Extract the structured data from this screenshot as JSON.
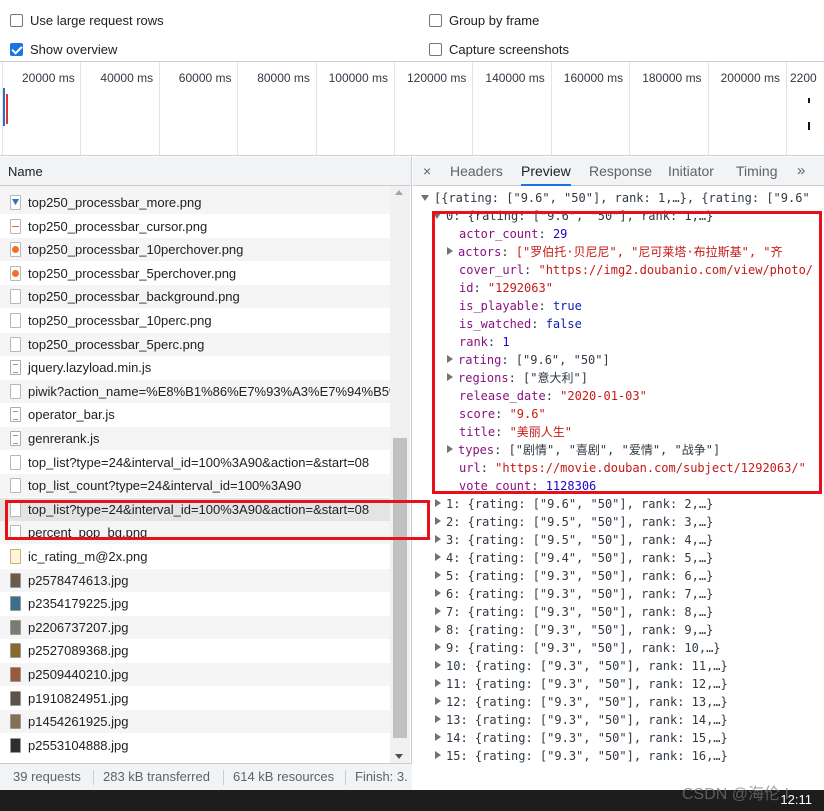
{
  "options": {
    "large_rows": "Use large request rows",
    "group_by_frame": "Group by frame",
    "show_overview": "Show overview",
    "capture_screenshots": "Capture screenshots"
  },
  "overview_ticks": [
    "20000 ms",
    "40000 ms",
    "60000 ms",
    "80000 ms",
    "100000 ms",
    "120000 ms",
    "140000 ms",
    "160000 ms",
    "180000 ms",
    "200000 ms",
    "2200"
  ],
  "list": {
    "header": "Name",
    "rows": [
      {
        "name": "top250_processbar_more.png",
        "icon": "img-blue"
      },
      {
        "name": "top250_processbar_cursor.png",
        "icon": "img-line"
      },
      {
        "name": "top250_processbar_10perchover.png",
        "icon": "img-orange"
      },
      {
        "name": "top250_processbar_5perchover.png",
        "icon": "img-orange"
      },
      {
        "name": "top250_processbar_background.png",
        "icon": "plain"
      },
      {
        "name": "top250_processbar_10perc.png",
        "icon": "plain"
      },
      {
        "name": "top250_processbar_5perc.png",
        "icon": "plain"
      },
      {
        "name": "jquery.lazyload.min.js",
        "icon": "js"
      },
      {
        "name": "piwik?action_name=%E8%B1%86%E7%93%A3%E7%94%B5%",
        "icon": "plain"
      },
      {
        "name": "operator_bar.js",
        "icon": "js"
      },
      {
        "name": "genrerank.js",
        "icon": "js"
      },
      {
        "name": "top_list?type=24&interval_id=100%3A90&action=&start=08",
        "icon": "plain"
      },
      {
        "name": "top_list_count?type=24&interval_id=100%3A90",
        "icon": "plain"
      },
      {
        "name": "top_list?type=24&interval_id=100%3A90&action=&start=08",
        "icon": "plain"
      },
      {
        "name": "percent_pop_bg.png",
        "icon": "plain"
      },
      {
        "name": "ic_rating_m@2x.png",
        "icon": "star"
      },
      {
        "name": "p2578474613.jpg",
        "icon": "photo1"
      },
      {
        "name": "p2354179225.jpg",
        "icon": "photo2"
      },
      {
        "name": "p2206737207.jpg",
        "icon": "photo3"
      },
      {
        "name": "p2527089368.jpg",
        "icon": "photo4"
      },
      {
        "name": "p2509440210.jpg",
        "icon": "photo5"
      },
      {
        "name": "p1910824951.jpg",
        "icon": "photo6"
      },
      {
        "name": "p1454261925.jpg",
        "icon": "photo7"
      },
      {
        "name": "p2553104888.jpg",
        "icon": "photo8"
      }
    ]
  },
  "tabs": {
    "close": "×",
    "items": [
      "Headers",
      "Preview",
      "Response",
      "Initiator",
      "Timing"
    ],
    "active": "Preview",
    "more": "»"
  },
  "preview": {
    "root": "[{rating: [\"9.6\", \"50\"], rank: 1,…}, {rating: [\"9.6\"",
    "item0_header": "0: {rating: [\"9.6\", \"50\"], rank: 1,…}",
    "fields": [
      {
        "key": "actor_count",
        "value": "29",
        "type": "n",
        "expandable": false
      },
      {
        "key": "actors",
        "value": "[\"罗伯托·贝尼尼\", \"尼可莱塔·布拉斯基\", \"齐",
        "type": "s",
        "expandable": true
      },
      {
        "key": "cover_url",
        "value": "\"https://img2.doubanio.com/view/photo/",
        "type": "s",
        "expandable": false
      },
      {
        "key": "id",
        "value": "\"1292063\"",
        "type": "s",
        "expandable": false
      },
      {
        "key": "is_playable",
        "value": "true",
        "type": "b",
        "expandable": false
      },
      {
        "key": "is_watched",
        "value": "false",
        "type": "b",
        "expandable": false
      },
      {
        "key": "rank",
        "value": "1",
        "type": "n",
        "expandable": false
      },
      {
        "key": "rating",
        "value": "[\"9.6\", \"50\"]",
        "type": "p",
        "expandable": true
      },
      {
        "key": "regions",
        "value": "[\"意大利\"]",
        "type": "p",
        "expandable": true
      },
      {
        "key": "release_date",
        "value": "\"2020-01-03\"",
        "type": "s",
        "expandable": false
      },
      {
        "key": "score",
        "value": "\"9.6\"",
        "type": "s",
        "expandable": false
      },
      {
        "key": "title",
        "value": "\"美丽人生\"",
        "type": "s",
        "expandable": false
      },
      {
        "key": "types",
        "value": "[\"剧情\", \"喜剧\", \"爱情\", \"战争\"]",
        "type": "p",
        "expandable": true
      },
      {
        "key": "url",
        "value": "\"https://movie.douban.com/subject/1292063/\"",
        "type": "s",
        "expandable": false
      },
      {
        "key": "vote_count",
        "value": "1128306",
        "type": "n",
        "expandable": false
      }
    ],
    "items": [
      "1: {rating: [\"9.6\", \"50\"], rank: 2,…}",
      "2: {rating: [\"9.5\", \"50\"], rank: 3,…}",
      "3: {rating: [\"9.5\", \"50\"], rank: 4,…}",
      "4: {rating: [\"9.4\", \"50\"], rank: 5,…}",
      "5: {rating: [\"9.3\", \"50\"], rank: 6,…}",
      "6: {rating: [\"9.3\", \"50\"], rank: 7,…}",
      "7: {rating: [\"9.3\", \"50\"], rank: 8,…}",
      "8: {rating: [\"9.3\", \"50\"], rank: 9,…}",
      "9: {rating: [\"9.3\", \"50\"], rank: 10,…}",
      "10: {rating: [\"9.3\", \"50\"], rank: 11,…}",
      "11: {rating: [\"9.3\", \"50\"], rank: 12,…}",
      "12: {rating: [\"9.3\", \"50\"], rank: 13,…}",
      "13: {rating: [\"9.3\", \"50\"], rank: 14,…}",
      "14: {rating: [\"9.3\", \"50\"], rank: 15,…}",
      "15: {rating: [\"9.3\", \"50\"], rank: 16,…}"
    ]
  },
  "status": {
    "requests": "39 requests",
    "transferred": "283 kB transferred",
    "resources": "614 kB resources",
    "finish": "Finish: 3."
  },
  "watermark": "CSDN @海伦 I",
  "clock": "12:11",
  "colors": {
    "accent": "#1a73e8",
    "annotation": "#e8101a"
  }
}
